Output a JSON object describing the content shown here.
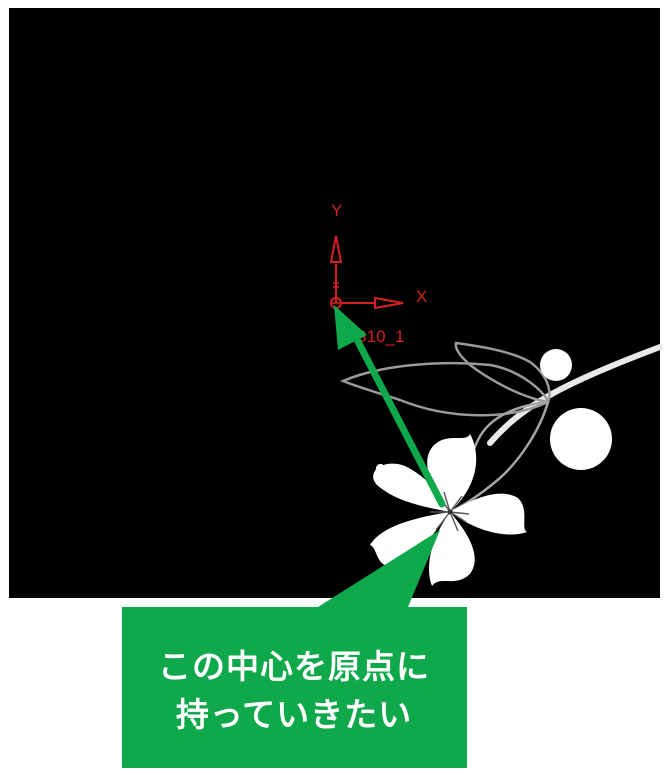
{
  "colors": {
    "viewport_background": "#000000",
    "page_background": "#ffffff",
    "coordinate_system": "#d42020",
    "callout": "#0fa84a",
    "callout_text": "#ffffff",
    "artwork": "#ffffff",
    "artwork_outline": "#8c8c8c"
  },
  "coordinate_system": {
    "x_label": "X",
    "y_label": "Y",
    "name": "CS10_1"
  },
  "icons": {
    "artwork": "cherry-blossom-artwork-icon",
    "arrow": "green-arrow-icon"
  },
  "callout": {
    "line1": "この中心を原点に",
    "line2": "持っていきたい"
  }
}
